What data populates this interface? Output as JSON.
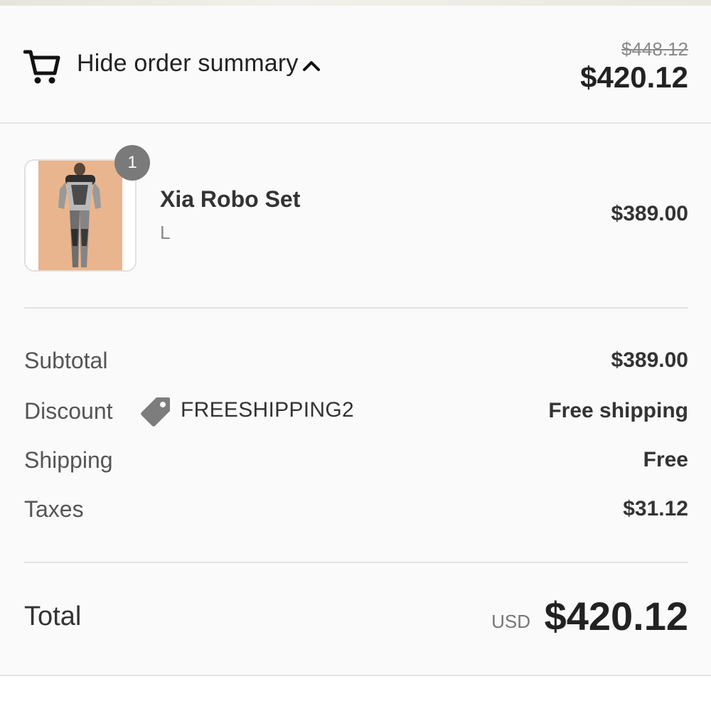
{
  "header": {
    "toggle_label": "Hide order summary",
    "compare_at_total": "$448.12",
    "total": "$420.12"
  },
  "line_item": {
    "quantity": "1",
    "name": "Xia Robo Set",
    "variant": "L",
    "price": "$389.00",
    "image_alt": "Xia Robo Set product photo"
  },
  "summary": {
    "subtotal": {
      "label": "Subtotal",
      "value": "$389.00"
    },
    "discount": {
      "label": "Discount",
      "code": "FREESHIPPING2",
      "value": "Free shipping"
    },
    "shipping": {
      "label": "Shipping",
      "value": "Free"
    },
    "taxes": {
      "label": "Taxes",
      "value": "$31.12"
    }
  },
  "total": {
    "label": "Total",
    "currency": "USD",
    "value": "$420.12"
  },
  "icons": {
    "cart": "shopping-cart-icon",
    "chevron": "chevron-up-icon",
    "tag": "discount-tag-icon"
  },
  "colors": {
    "background": "#fafafa",
    "badge": "#7a7a7a",
    "text": "#333333",
    "muted": "#8a8a8a"
  }
}
